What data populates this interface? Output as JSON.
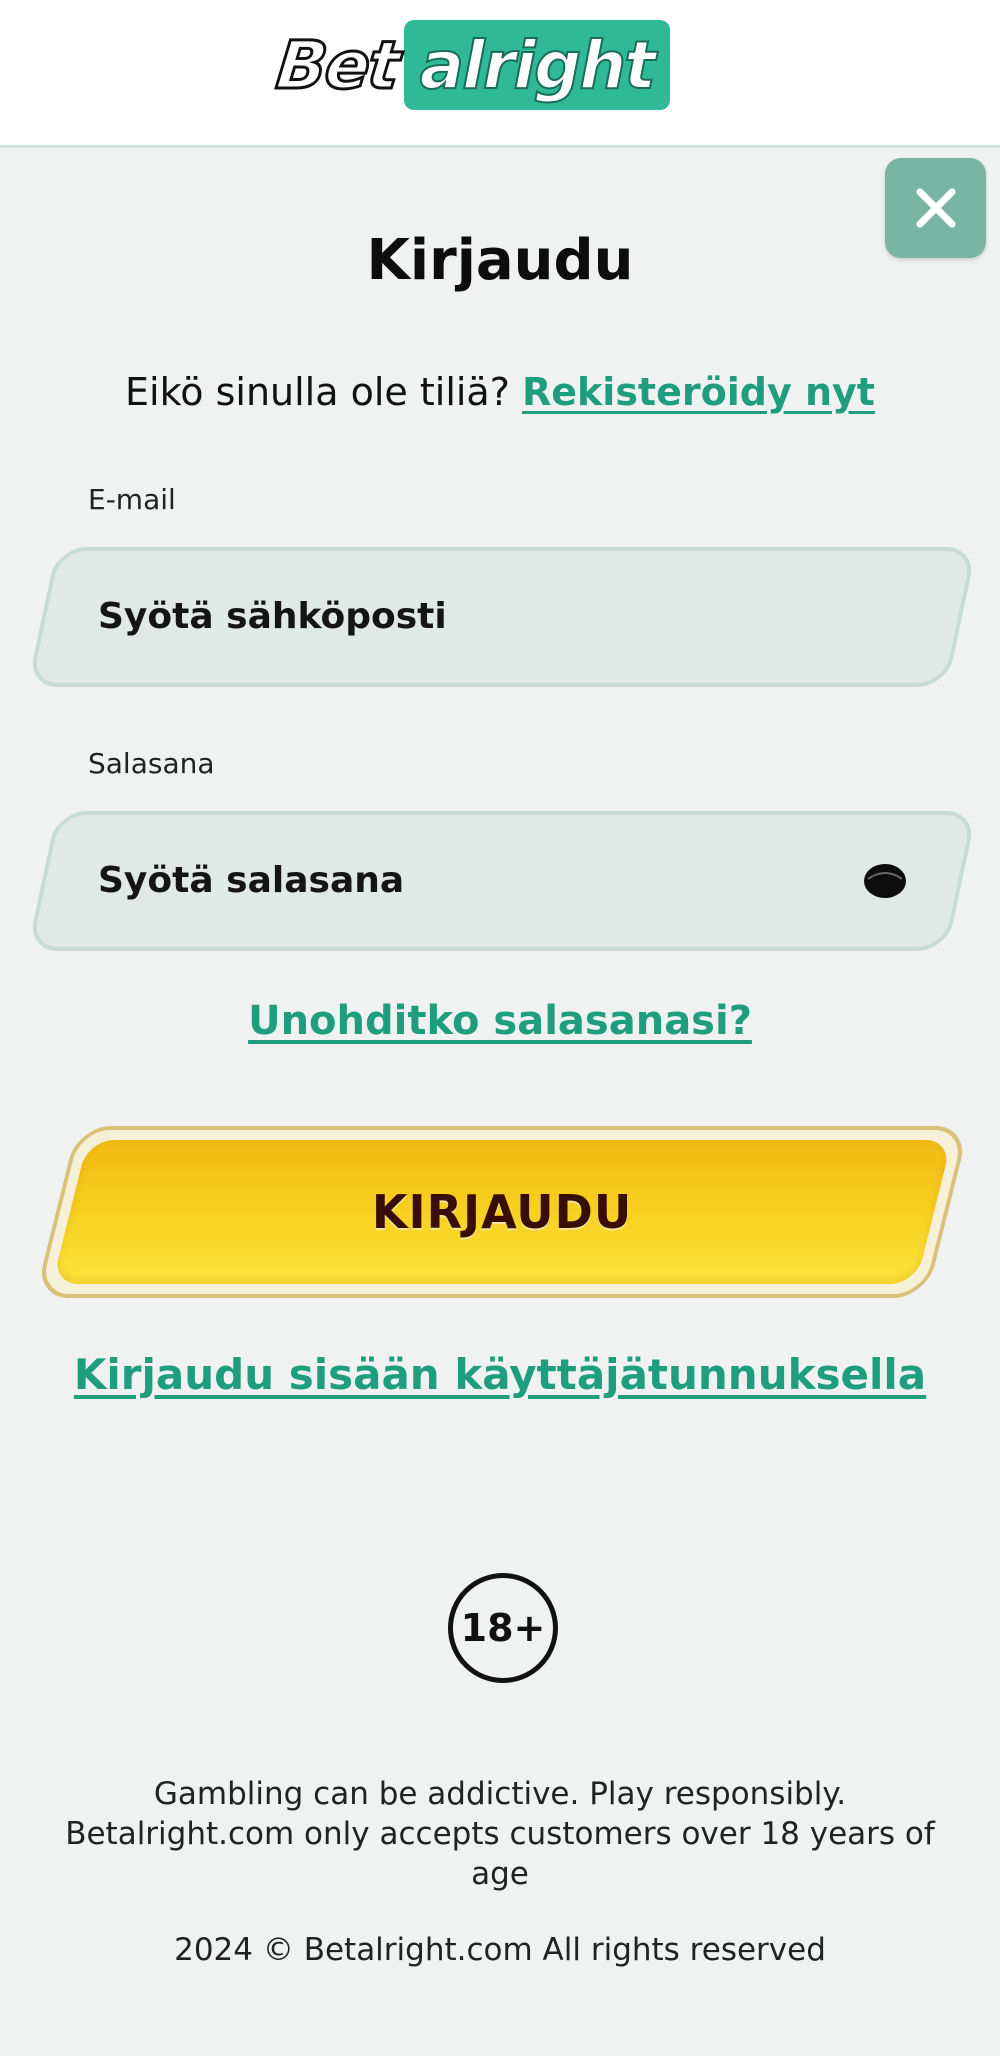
{
  "header": {
    "logo_bet": "Bet",
    "logo_alright": "alright"
  },
  "colors": {
    "accent": "#2fb996",
    "link": "#1f9e7e",
    "close_bg": "#78b5a2",
    "button_gold": "#f6cf1e",
    "background": "#eff2f1"
  },
  "modal": {
    "close_icon": "close-icon",
    "title": "Kirjaudu",
    "register_prompt": "Eikö sinulla ole tiliä?",
    "register_link": "Rekisteröidy nyt",
    "email": {
      "label": "E-mail",
      "placeholder": "Syötä sähköposti",
      "value": ""
    },
    "password": {
      "label": "Salasana",
      "placeholder": "Syötä salasana",
      "value": "",
      "toggle_icon": "eye-icon"
    },
    "forgot_link": "Unohditko salasanasi?",
    "submit_label": "KIRJAUDU",
    "username_login_link": "Kirjaudu sisään käyttäjätunnuksella"
  },
  "footer": {
    "age_badge": "18+",
    "disclaimer_line1": "Gambling can be addictive. Play responsibly.",
    "disclaimer_line2": "Betalright.com only accepts customers over 18 years of age",
    "copyright": "2024 © Betalright.com All rights reserved"
  }
}
